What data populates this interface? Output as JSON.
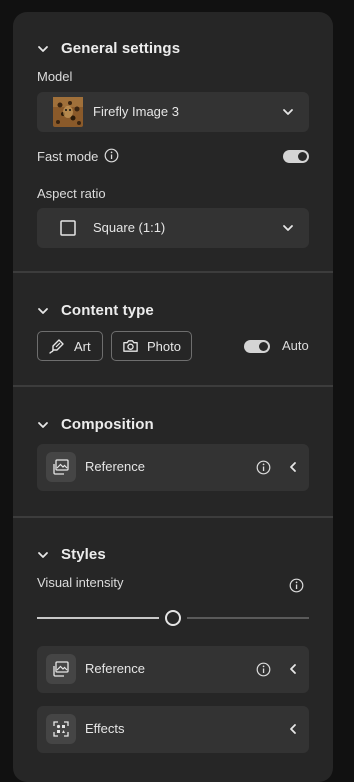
{
  "general": {
    "title": "General settings",
    "model_label": "Model",
    "model_value": "Firefly Image 3",
    "fast_mode_label": "Fast mode",
    "fast_mode_on": true,
    "aspect_label": "Aspect ratio",
    "aspect_value": "Square (1:1)"
  },
  "content_type": {
    "title": "Content type",
    "art_label": "Art",
    "photo_label": "Photo",
    "auto_label": "Auto",
    "auto_on": true
  },
  "composition": {
    "title": "Composition",
    "reference_label": "Reference"
  },
  "styles": {
    "title": "Styles",
    "visual_intensity_label": "Visual intensity",
    "visual_intensity_value": 0.5,
    "reference_label": "Reference",
    "effects_label": "Effects"
  },
  "colors": {
    "panel": "#262626",
    "field": "#333333",
    "toggle": "#d4d4d4"
  }
}
